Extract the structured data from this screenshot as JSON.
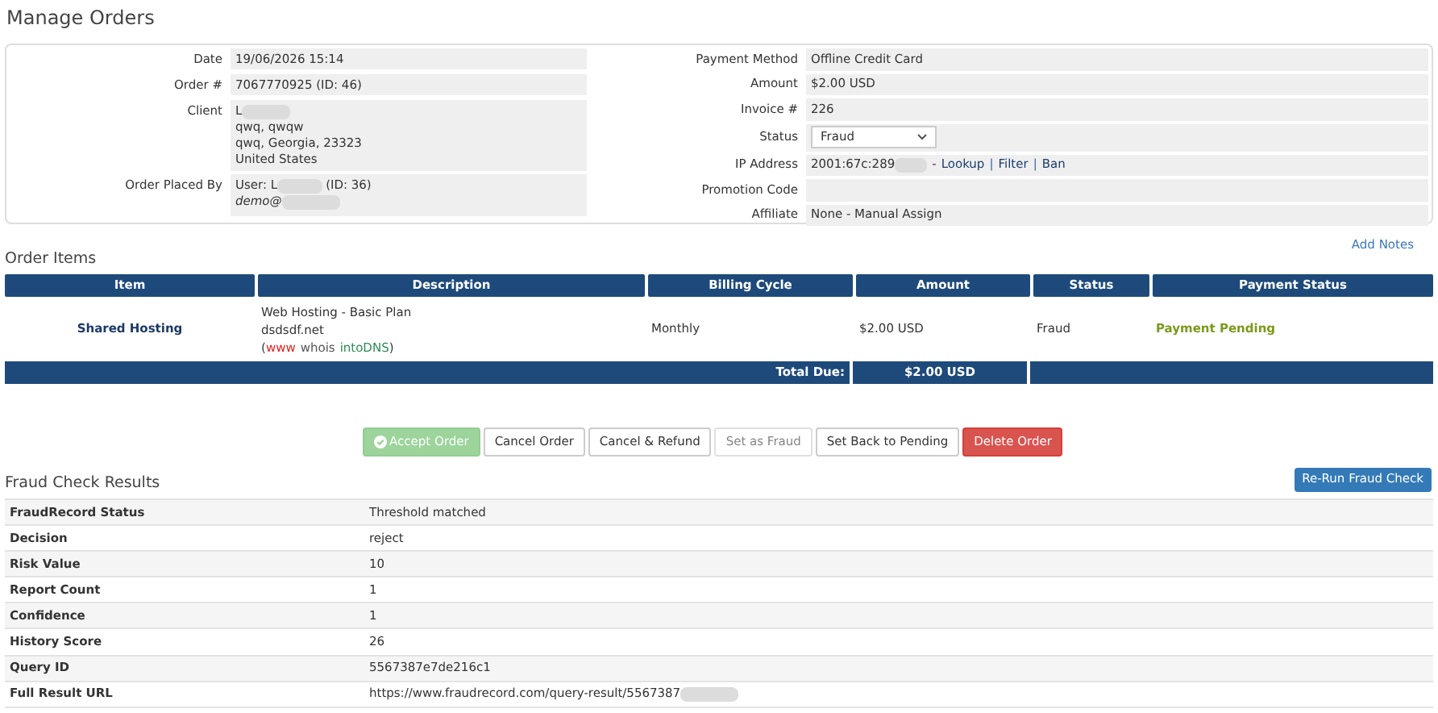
{
  "page_title": "Manage Orders",
  "order_info": {
    "left": [
      {
        "label": "Date",
        "lines": [
          "19/06/2026 15:14"
        ]
      },
      {
        "label": "Order #",
        "lines": [
          "7067770925 (ID: 46)"
        ]
      },
      {
        "label": "Client",
        "kind": "link",
        "lines": [
          "L",
          "qwq, qwqw",
          "qwq, Georgia, 23323",
          "United States"
        ]
      },
      {
        "label": "Order Placed By",
        "lines": [
          "User: L",
          "(ID: 36)",
          "demo@"
        ],
        "kind": "user"
      }
    ],
    "right": [
      {
        "label": "Payment Method",
        "value": "Offline Credit Card"
      },
      {
        "label": "Amount",
        "value": "$2.00 USD"
      },
      {
        "label": "Invoice #",
        "value": "226"
      },
      {
        "label": "Status",
        "value": "Fraud",
        "kind": "select"
      },
      {
        "label": "IP Address",
        "value": "2001:67c:289",
        "kind": "ip",
        "links": [
          {
            "sep": "-",
            "label": "Lookup"
          },
          {
            "sep": "|",
            "label": "Filter"
          },
          {
            "sep": "|",
            "label": "Ban"
          }
        ]
      },
      {
        "label": "Promotion Code"
      },
      {
        "label": "Affiliate",
        "value": "None - Manual Assign"
      }
    ]
  },
  "order_items": {
    "title": "Order Items",
    "add_notes": "Add Notes",
    "columns": [
      "Item",
      "Description",
      "Billing Cycle",
      "Amount",
      "Status",
      "Payment Status"
    ],
    "rows": [
      {
        "item": "Shared Hosting",
        "description": [
          "Web Hosting - Basic Plan",
          "dsdsdf.net"
        ],
        "links_open": "(",
        "links": [
          "www",
          "whois",
          "intoDNS"
        ],
        "links_close": ")",
        "billing_cycle": "Monthly",
        "amount": "$2.00 USD",
        "status": "Fraud",
        "payment_status": "Payment Pending"
      }
    ],
    "total_label": "Total Due:",
    "total": "$2.00 USD"
  },
  "actions": [
    {
      "label": "Accept Order",
      "kind": "success",
      "disabled": true
    },
    {
      "label": "Cancel Order",
      "kind": "default",
      "disabled": false
    },
    {
      "label": "Cancel & Refund",
      "kind": "default",
      "disabled": false
    },
    {
      "label": "Set as Fraud",
      "kind": "default",
      "disabled": true
    },
    {
      "label": "Set Back to Pending",
      "kind": "default",
      "disabled": false
    },
    {
      "label": "Delete Order",
      "kind": "danger",
      "disabled": false
    }
  ],
  "fraud_check": {
    "title": "Fraud Check Results",
    "rerun_button": "Re-Run Fraud Check",
    "rows": [
      {
        "label": "FraudRecord Status",
        "value": "Threshold matched"
      },
      {
        "label": "Decision",
        "value": "reject"
      },
      {
        "label": "Risk Value",
        "value": "10"
      },
      {
        "label": "Report Count",
        "value": "1"
      },
      {
        "label": "Confidence",
        "value": "1"
      },
      {
        "label": "History Score",
        "value": "26"
      },
      {
        "label": "Query ID",
        "value": "5567387e7de216c1"
      },
      {
        "label": "Full Result URL",
        "value": "https://www.fraudrecord.com/query-result/5567387"
      }
    ]
  }
}
